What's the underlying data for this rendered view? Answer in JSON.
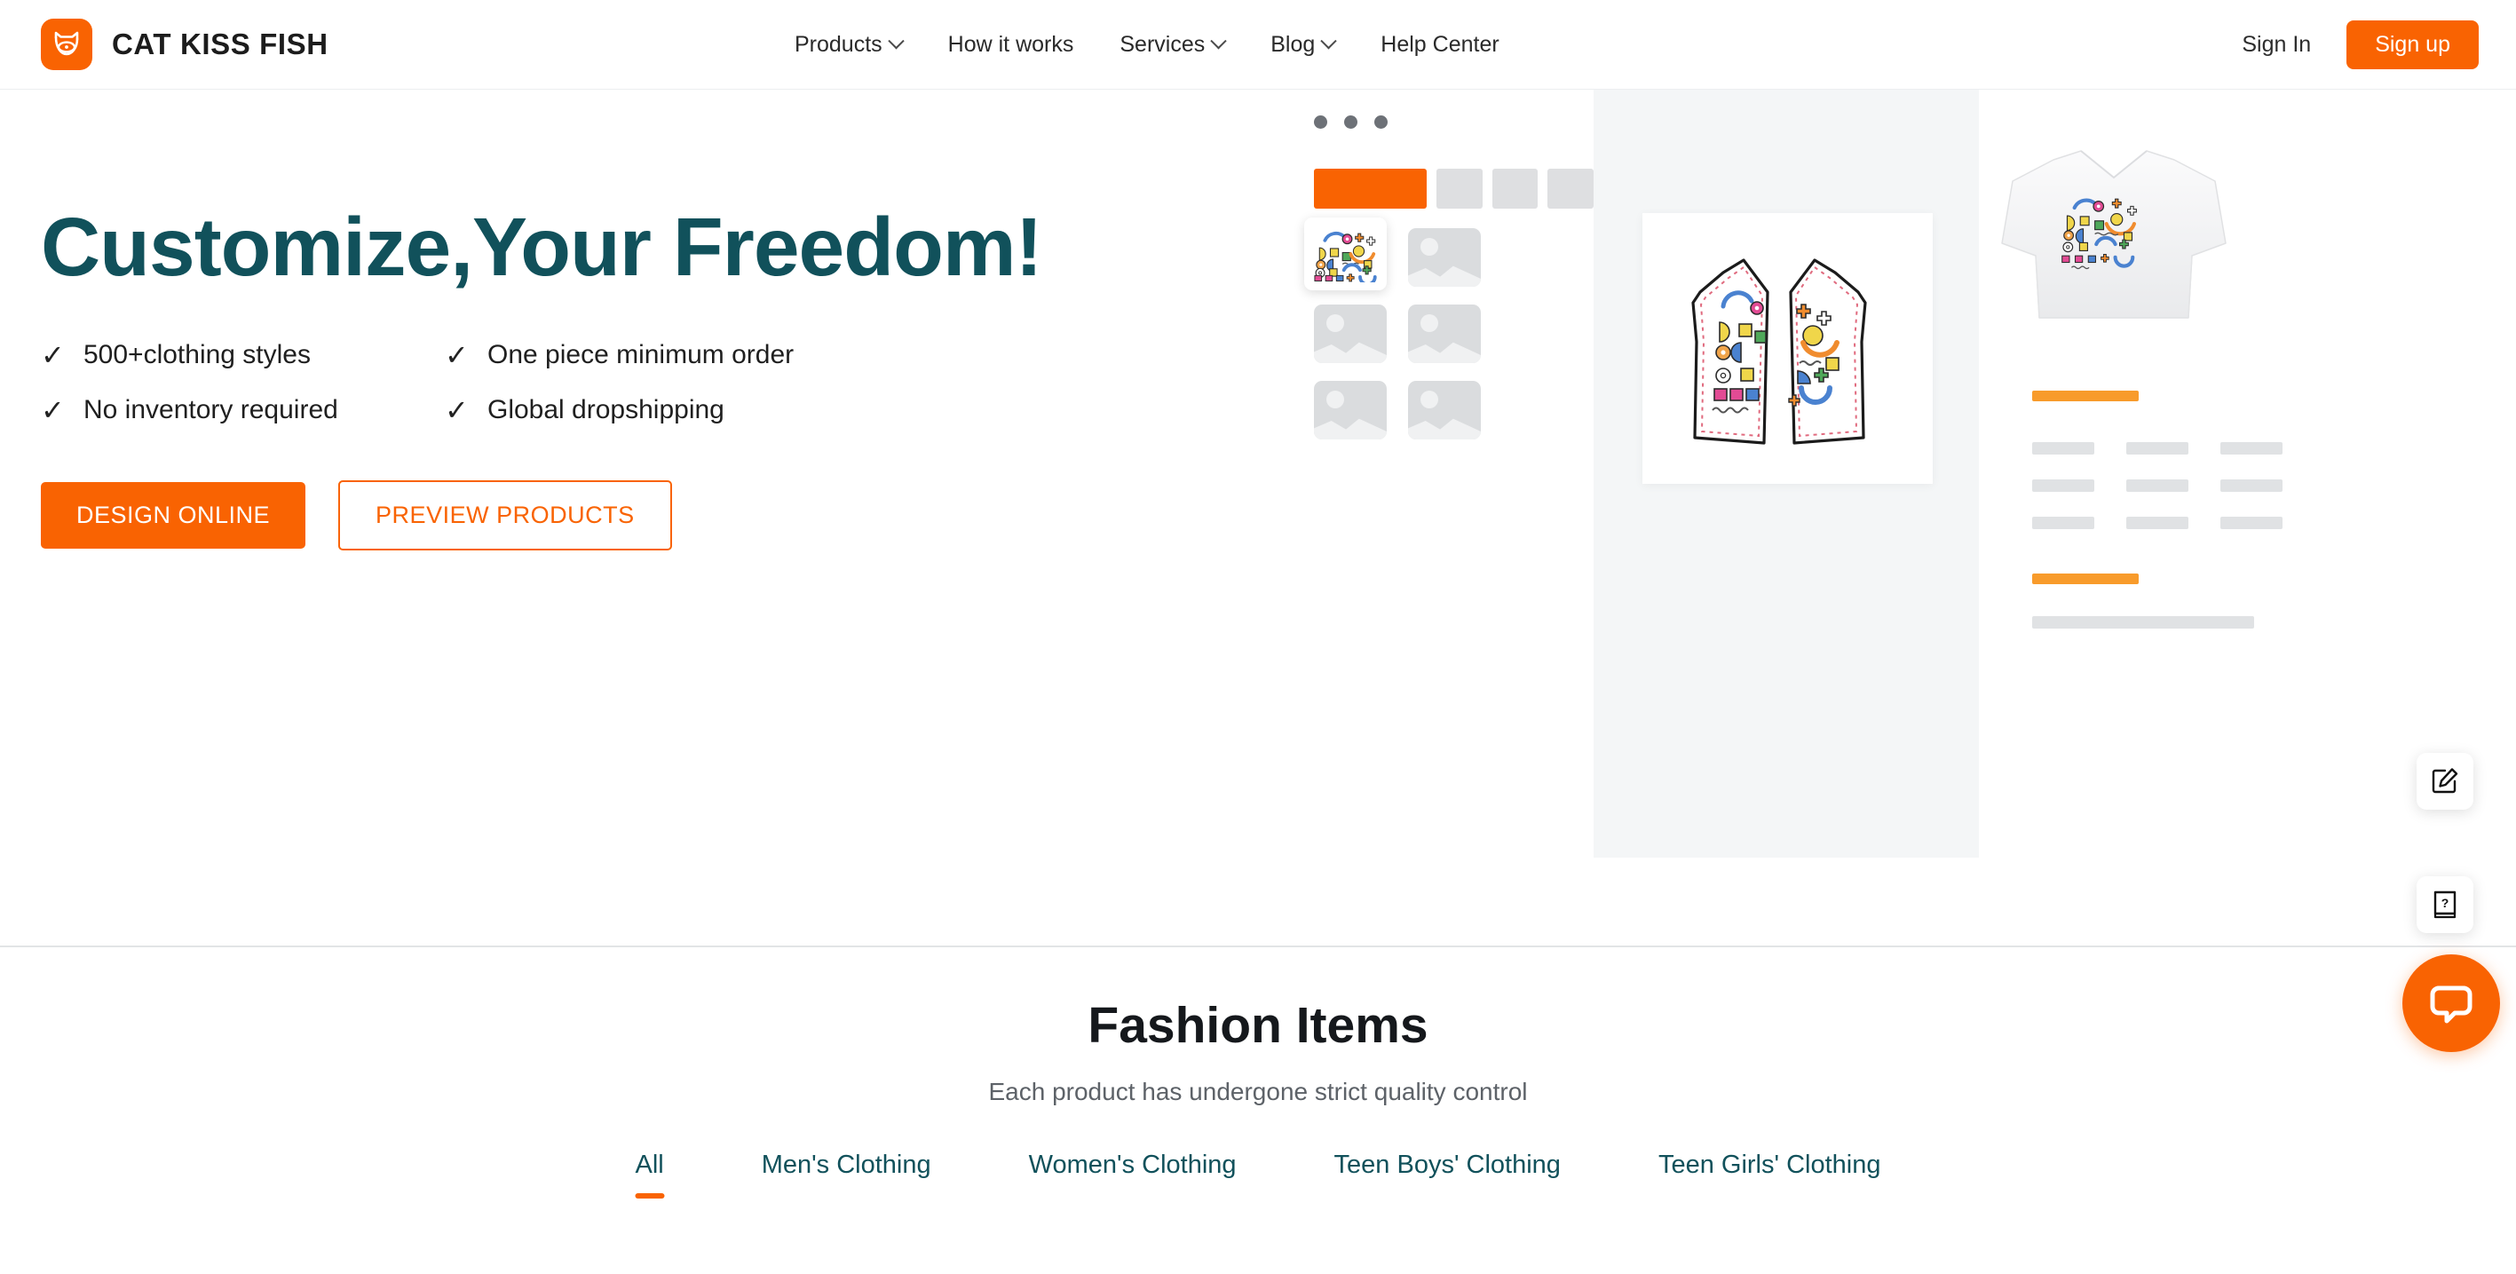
{
  "header": {
    "brand_name": "CAT KISS FISH",
    "logo_icon": "cat-fish-logo-icon",
    "nav": [
      {
        "label": "Products",
        "has_dropdown": true
      },
      {
        "label": "How it works",
        "has_dropdown": false
      },
      {
        "label": "Services",
        "has_dropdown": true
      },
      {
        "label": "Blog",
        "has_dropdown": true
      },
      {
        "label": "Help Center",
        "has_dropdown": false
      }
    ],
    "sign_in_label": "Sign In",
    "sign_up_label": "Sign up"
  },
  "hero": {
    "title": "Customize,Your Freedom!",
    "features": [
      {
        "check": "✓",
        "text": "500+clothing styles"
      },
      {
        "check": "✓",
        "text": "One piece minimum order"
      },
      {
        "check": "✓",
        "text": "No inventory required"
      },
      {
        "check": "✓",
        "text": "Global dropshipping"
      }
    ],
    "primary_cta": "DESIGN ONLINE",
    "secondary_cta": "PREVIEW PRODUCTS"
  },
  "mock": {
    "window_dots": 3,
    "tabs": [
      {
        "active": true
      },
      {
        "active": false
      },
      {
        "active": false
      },
      {
        "active": false
      }
    ],
    "thumbnails_total": 7,
    "selected_thumbnail_index": 0,
    "canvas_item": "vest-pattern-design",
    "preview_item": "white-shirt-with-print"
  },
  "floating": {
    "edit_icon": "edit-pencil-icon",
    "help_icon": "help-book-icon",
    "chat_icon": "chat-bubble-icon"
  },
  "section": {
    "title": "Fashion Items",
    "subtitle": "Each product has undergone strict quality control",
    "categories": [
      {
        "label": "All",
        "active": true
      },
      {
        "label": "Men's Clothing",
        "active": false
      },
      {
        "label": "Women's Clothing",
        "active": false
      },
      {
        "label": "Teen Boys' Clothing",
        "active": false
      },
      {
        "label": "Teen Girls' Clothing",
        "active": false
      }
    ]
  },
  "colors": {
    "brand_orange": "#F96302",
    "bar_orange": "#F89B2B",
    "heading_teal": "#11515B",
    "canvas_gray": "#F4F6F7",
    "placeholder_gray": "#DADCDE"
  }
}
